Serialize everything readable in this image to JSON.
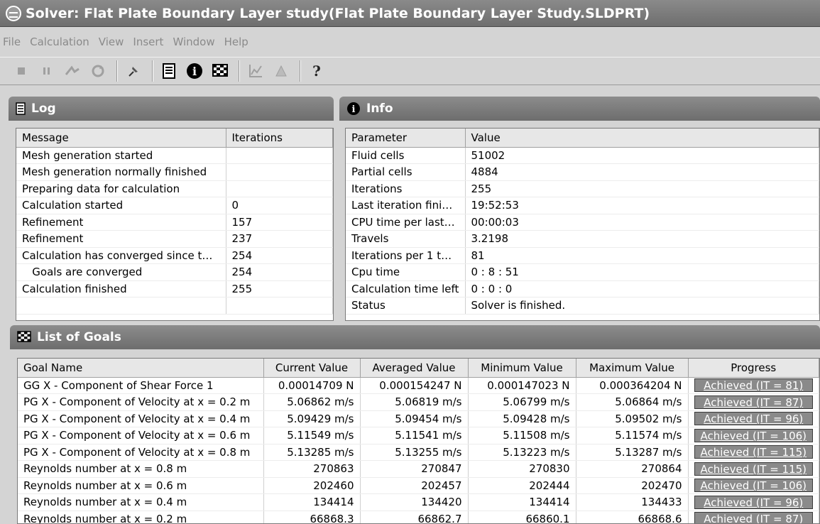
{
  "window": {
    "title": "Solver: Flat Plate Boundary Layer study(Flat Plate Boundary Layer Study.SLDPRT)"
  },
  "menu": [
    "File",
    "Calculation",
    "View",
    "Insert",
    "Window",
    "Help"
  ],
  "toolbar": {
    "icons": [
      "stop-icon",
      "pause-icon",
      "step-icon",
      "refresh-icon",
      "pin-icon",
      "log-icon",
      "info-icon",
      "goals-icon",
      "plot-icon",
      "preview-icon",
      "help-icon"
    ]
  },
  "log": {
    "title": "Log",
    "columns": [
      "Message",
      "Iterations"
    ],
    "rows": [
      [
        "Mesh generation started",
        ""
      ],
      [
        "Mesh generation normally finished",
        ""
      ],
      [
        "Preparing data for calculation",
        ""
      ],
      [
        "Calculation started",
        "0"
      ],
      [
        "Refinement",
        "157"
      ],
      [
        "Refinement",
        "237"
      ],
      [
        "Calculation has converged since t…",
        "254"
      ],
      [
        "   Goals are converged",
        "254"
      ],
      [
        "Calculation finished",
        "255"
      ]
    ]
  },
  "info": {
    "title": "Info",
    "columns": [
      "Parameter",
      "Value"
    ],
    "rows": [
      [
        "Fluid cells",
        "51002"
      ],
      [
        "Partial cells",
        "4884"
      ],
      [
        "Iterations",
        "255"
      ],
      [
        "Last iteration fini…",
        "19:52:53"
      ],
      [
        "CPU time per last…",
        "00:00:03"
      ],
      [
        "Travels",
        "3.2198"
      ],
      [
        "Iterations per 1 t…",
        "81"
      ],
      [
        "Cpu time",
        "0 : 8 : 51"
      ],
      [
        "Calculation time left",
        "0 : 0 : 0"
      ],
      [
        "Status",
        "Solver is finished."
      ]
    ]
  },
  "goals": {
    "title": "List of Goals",
    "columns": [
      "Goal Name",
      "Current Value",
      "Averaged Value",
      "Minimum Value",
      "Maximum Value",
      "Progress"
    ],
    "rows": [
      [
        "GG X - Component of Shear Force 1",
        "0.00014709 N",
        "0.000154247 N",
        "0.000147023 N",
        "0.000364204 N",
        "Achieved (IT = 81)"
      ],
      [
        "PG X - Component of Velocity at x = 0.2 m",
        "5.06862 m/s",
        "5.06819 m/s",
        "5.06799 m/s",
        "5.06864 m/s",
        "Achieved (IT = 87)"
      ],
      [
        "PG X - Component of Velocity at x = 0.4 m",
        "5.09429 m/s",
        "5.09454 m/s",
        "5.09428 m/s",
        "5.09502 m/s",
        "Achieved (IT = 96)"
      ],
      [
        "PG X - Component of Velocity at x = 0.6 m",
        "5.11549 m/s",
        "5.11541 m/s",
        "5.11508 m/s",
        "5.11574 m/s",
        "Achieved (IT = 106)"
      ],
      [
        "PG X - Component of Velocity at x = 0.8 m",
        "5.13285 m/s",
        "5.13255 m/s",
        "5.13223 m/s",
        "5.13287 m/s",
        "Achieved (IT = 115)"
      ],
      [
        "Reynolds number at x = 0.8 m",
        "270863",
        "270847",
        "270830",
        "270864",
        "Achieved (IT = 115)"
      ],
      [
        "Reynolds number at x = 0.6 m",
        "202460",
        "202457",
        "202444",
        "202470",
        "Achieved (IT = 106)"
      ],
      [
        "Reynolds number at x = 0.4 m",
        "134414",
        "134420",
        "134414",
        "134433",
        "Achieved (IT = 96)"
      ],
      [
        "Reynolds number at x = 0.2 m",
        "66868.3",
        "66862.7",
        "66860.1",
        "66868.6",
        "Achieved (IT = 87)"
      ]
    ]
  }
}
